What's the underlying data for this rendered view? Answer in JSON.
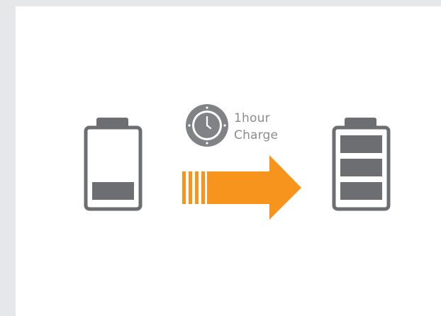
{
  "caption": {
    "duration": "1hour",
    "action": "Charge"
  },
  "icons": {
    "empty_battery": "battery-low-icon",
    "clock": "clock-icon",
    "arrow": "arrow-right-icon",
    "full_battery": "battery-full-icon"
  },
  "levels": {
    "before_bars": 1,
    "after_bars": 3,
    "max_bars": 3
  },
  "colors": {
    "battery_gray": "#6d6e71",
    "clock_gray": "#808285",
    "arrow_orange": "#f7941d",
    "text_gray": "#8a8c8e",
    "page_background": "#e6e7e8",
    "card_background": "#ffffff"
  }
}
